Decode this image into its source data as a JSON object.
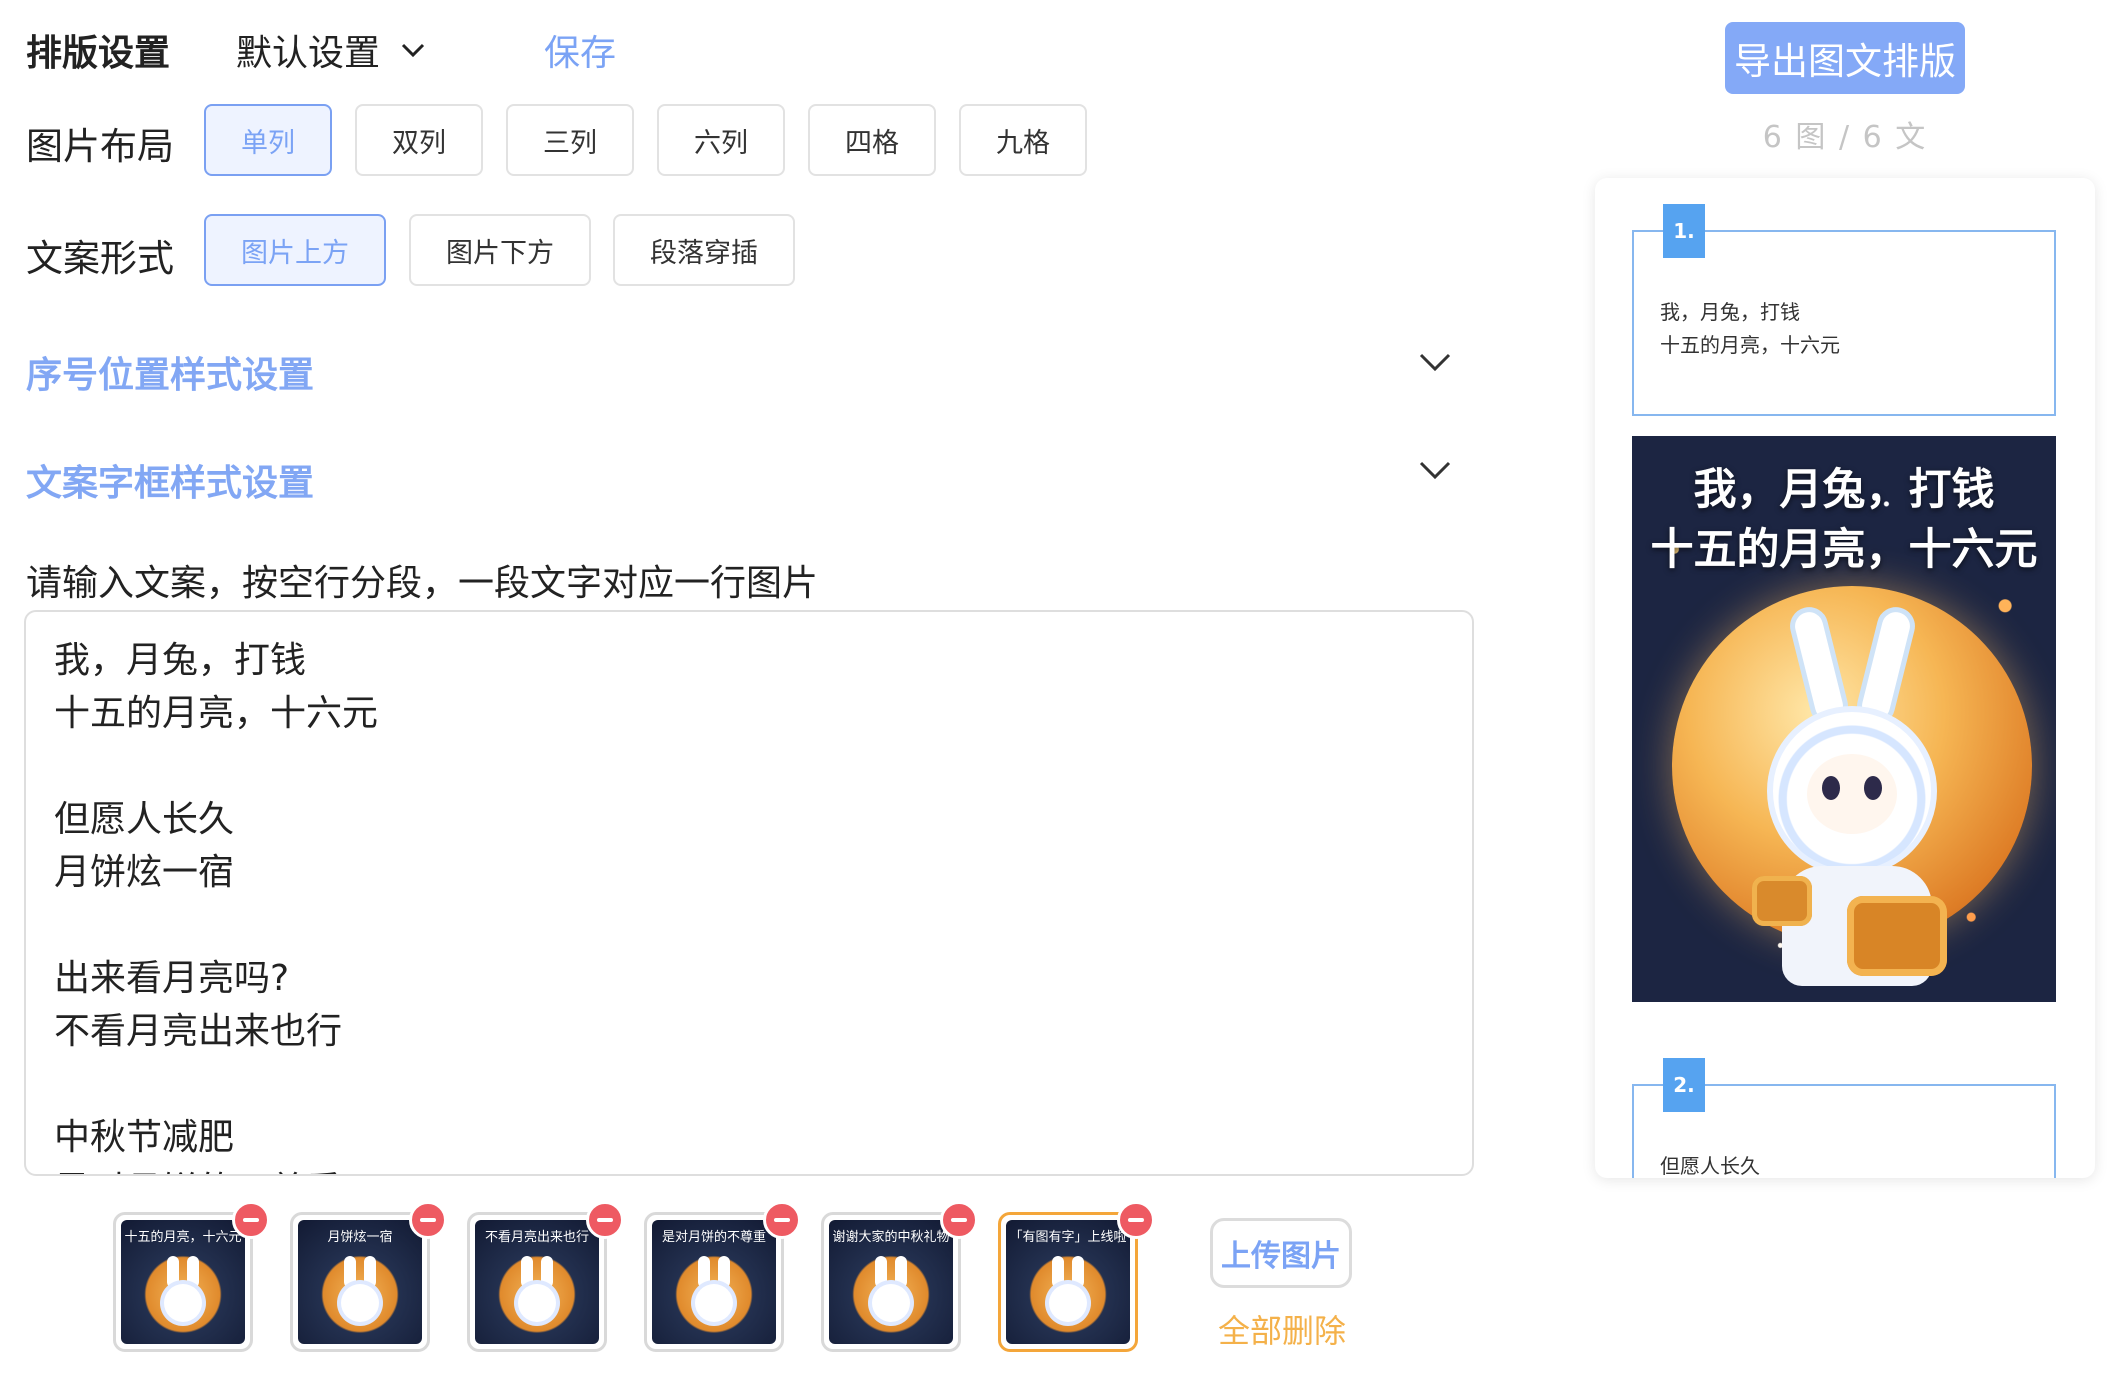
{
  "header": {
    "title": "排版设置",
    "preset_label": "默认设置",
    "save_label": "保存"
  },
  "layout": {
    "label": "图片布局",
    "options": [
      "单列",
      "双列",
      "三列",
      "六列",
      "四格",
      "九格"
    ],
    "selected": "单列"
  },
  "caption_mode": {
    "label": "文案形式",
    "options": [
      "图片上方",
      "图片下方",
      "段落穿插"
    ],
    "selected": "图片上方"
  },
  "sections": {
    "number_style": "序号位置样式设置",
    "textbox_style": "文案字框样式设置"
  },
  "editor": {
    "prompt": "请输入文案，按空行分段，一段文字对应一行图片",
    "lines": [
      "我，月兔，打钱",
      "十五的月亮，十六元",
      "",
      "但愿人长久",
      "月饼炫一宿",
      "",
      "出来看月亮吗?",
      "不看月亮出来也行",
      "",
      "中秋节减肥",
      "是对月饼的不尊重"
    ]
  },
  "thumbnails": [
    {
      "caption": "十五的月亮，十六元",
      "selected": false
    },
    {
      "caption": "月饼炫一宿",
      "selected": false
    },
    {
      "caption": "不看月亮出来也行",
      "selected": false
    },
    {
      "caption": "是对月饼的不尊重",
      "selected": false
    },
    {
      "caption": "谢谢大家的中秋礼物",
      "selected": false
    },
    {
      "caption": "「有图有字」上线啦",
      "selected": true
    }
  ],
  "actions": {
    "upload_label": "上传图片",
    "delete_all_label": "全部删除",
    "export_label": "导出图文排版",
    "counts": "6 图 / 6 文"
  },
  "preview": {
    "blocks": [
      {
        "badge": "1.",
        "lines": [
          "我，月兔，打钱",
          "十五的月亮，十六元"
        ]
      },
      {
        "badge": "2.",
        "lines": [
          "但愿人长久"
        ]
      }
    ],
    "poster_title_lines": [
      "我，月兔，打钱",
      "十五的月亮，十六元"
    ]
  },
  "colors": {
    "accent": "#7ba3f5",
    "export_button": "#84a9f7",
    "remove_badge": "#ee5a62",
    "delete_all": "#f4b14a",
    "selected_thumb_border": "#f4a63a",
    "number_badge": "#56a3f0"
  },
  "icons": {
    "preset_dropdown": "chevron-down-icon",
    "section_toggle": "chevron-down-icon",
    "remove": "minus-circle-icon"
  }
}
